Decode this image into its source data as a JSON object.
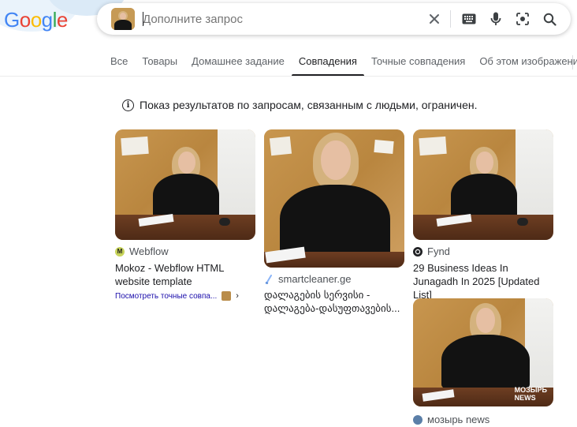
{
  "logo": {
    "letters": [
      "G",
      "o",
      "o",
      "g",
      "l",
      "e"
    ],
    "colors": [
      "#4285f4",
      "#ea4335",
      "#fbbc05",
      "#4285f4",
      "#34a853",
      "#ea4335"
    ]
  },
  "search": {
    "placeholder": "Дополните запрос",
    "value": "",
    "icons": [
      "close-icon",
      "keyboard-icon",
      "mic-icon",
      "lens-icon",
      "search-icon"
    ]
  },
  "tabs": [
    {
      "label": "Все",
      "active": false
    },
    {
      "label": "Товары",
      "active": false
    },
    {
      "label": "Домашнее задание",
      "active": false
    },
    {
      "label": "Совпадения",
      "active": true
    },
    {
      "label": "Точные совпадения",
      "active": false
    },
    {
      "label": "Об этом изображении",
      "active": false
    }
  ],
  "notice": {
    "text": "Показ результатов по запросам, связанным с людьми, ограничен."
  },
  "results": [
    {
      "source": "Webflow",
      "favicon_letter": "M",
      "favicon_color": "#1f1f1f",
      "title": "Mokoz - Webflow HTML website template",
      "exact_link": "Посмотреть точные совпа..."
    },
    {
      "source": "smartcleaner.ge",
      "favicon_letter": "",
      "favicon_color": "#8ab4f8",
      "title": "დალაგების სერვისი - დალაგება-დასუფთავების..."
    },
    {
      "source": "Fynd",
      "favicon_letter": "",
      "favicon_color": "#202124",
      "title": "29 Business Ideas In Junagadh In 2025 [Updated List]"
    },
    {
      "source": "мозырь news",
      "favicon_letter": "",
      "favicon_color": "#5b7fa8",
      "title": "",
      "watermark": "МОЗЫРЬ\nNEWS"
    }
  ],
  "colors": {
    "accent": "#1a0dab",
    "text": "#202124",
    "muted": "#5f6368"
  }
}
